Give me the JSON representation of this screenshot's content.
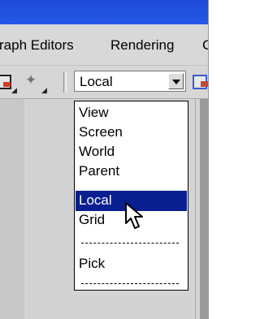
{
  "menubar": {
    "items": [
      "raph Editors",
      "Rendering",
      "C"
    ]
  },
  "toolbar": {
    "coordinate_system": {
      "selected": "Local"
    },
    "icons": [
      "select-region-icon",
      "axis-constraint-icon",
      "pivot-center-icon"
    ]
  },
  "dropdown": {
    "items": [
      {
        "label": "View",
        "selected": false
      },
      {
        "label": "Screen",
        "selected": false
      },
      {
        "label": "World",
        "selected": false
      },
      {
        "label": "Parent",
        "selected": false
      },
      {
        "label": "Local",
        "selected": true
      },
      {
        "label": "Grid",
        "selected": false
      },
      {
        "label": "---separator---",
        "separator": true
      },
      {
        "label": "Pick",
        "selected": false
      },
      {
        "label": "---separator---",
        "separator": true
      }
    ]
  },
  "colors": {
    "titlebar": "#2557e8",
    "selection": "#0a1f8f",
    "chrome": "#d8d8d8"
  }
}
